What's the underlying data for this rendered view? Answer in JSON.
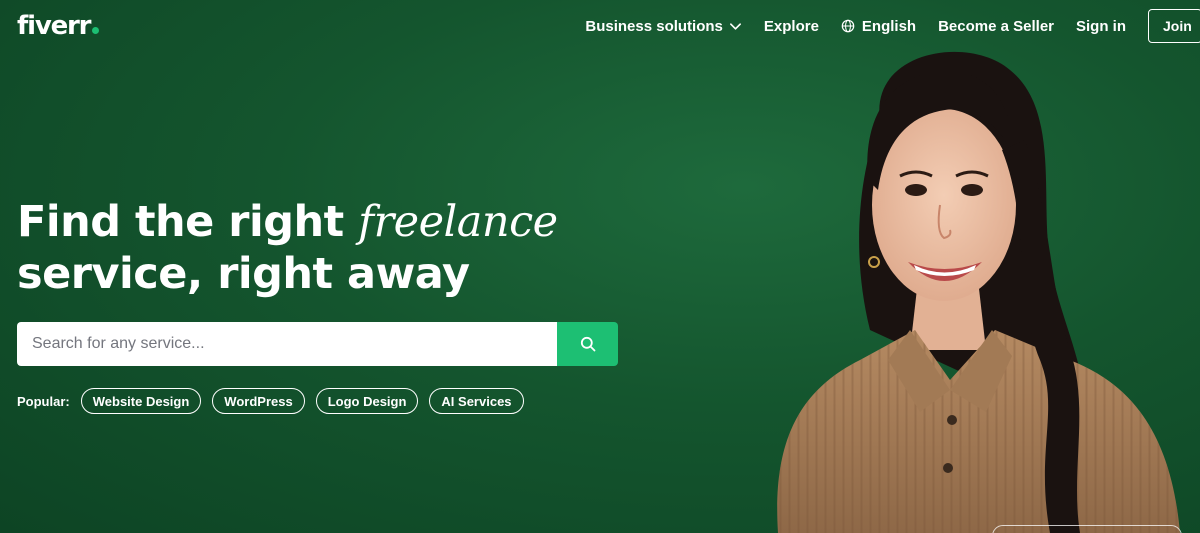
{
  "brand": {
    "logo_text": "fiverr",
    "accent_color": "#1dbf73",
    "background_color": "#14552e"
  },
  "nav": {
    "business_solutions": "Business solutions",
    "explore": "Explore",
    "language": "English",
    "become_seller": "Become a Seller",
    "sign_in": "Sign in",
    "join": "Join"
  },
  "hero": {
    "headline_part1": "Find the right",
    "headline_italic": "freelance",
    "headline_part2": "service, right away"
  },
  "search": {
    "placeholder": "Search for any service...",
    "value": "",
    "button_icon": "search-icon"
  },
  "popular": {
    "label": "Popular:",
    "tags": [
      "Website Design",
      "WordPress",
      "Logo Design",
      "AI Services"
    ]
  }
}
